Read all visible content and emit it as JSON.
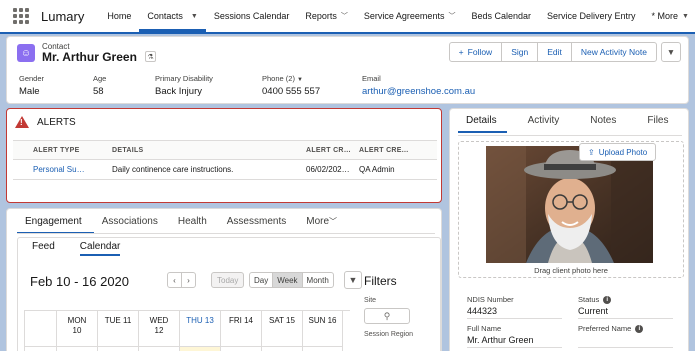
{
  "app": {
    "name": "Lumary"
  },
  "nav": {
    "items": [
      {
        "label": "Home"
      },
      {
        "label": "Contacts"
      },
      {
        "label": "Sessions Calendar"
      },
      {
        "label": "Reports"
      },
      {
        "label": "Service Agreements"
      },
      {
        "label": "Beds Calendar"
      },
      {
        "label": "Service Delivery Entry"
      },
      {
        "label": "* More"
      }
    ]
  },
  "record": {
    "type_label": "Contact",
    "name": "Mr. Arthur Green",
    "actions": {
      "follow": "Follow",
      "sign": "Sign",
      "edit": "Edit",
      "new_activity": "New Activity Note"
    },
    "fields": {
      "gender": {
        "label": "Gender",
        "value": "Male"
      },
      "age": {
        "label": "Age",
        "value": "58"
      },
      "disability": {
        "label": "Primary Disability",
        "value": "Back Injury"
      },
      "phone": {
        "label": "Phone (2)",
        "value": "0400 555 557"
      },
      "email": {
        "label": "Email",
        "value": "arthur@greenshoe.com.au"
      }
    }
  },
  "alerts": {
    "title": "ALERTS",
    "columns": [
      "ALERT TYPE",
      "DETAILS",
      "ALERT CREAT...",
      "ALERT CRE..."
    ],
    "rows": [
      {
        "type": "Personal Supp...",
        "details": "Daily continence care instructions.",
        "created": "06/02/2020 3:...",
        "creator": "QA Admin"
      }
    ]
  },
  "engagement": {
    "tabs": [
      "Engagement",
      "Associations",
      "Health",
      "Assessments",
      "More"
    ],
    "subtabs": [
      "Feed",
      "Calendar"
    ],
    "calendar": {
      "range": "Feb 10 - 16 2020",
      "today_label": "Today",
      "views": [
        "Day",
        "Week",
        "Month"
      ],
      "days": [
        {
          "name": "MON",
          "num": "10"
        },
        {
          "name": "TUE 11",
          "num": ""
        },
        {
          "name": "WED",
          "num": "12"
        },
        {
          "name": "THU 13",
          "num": ""
        },
        {
          "name": "FRI 14",
          "num": ""
        },
        {
          "name": "SAT 15",
          "num": ""
        },
        {
          "name": "SUN 16",
          "num": ""
        }
      ]
    },
    "filters": {
      "title": "Filters",
      "site_label": "Site",
      "region_label": "Session Region"
    }
  },
  "details_panel": {
    "tabs": [
      "Details",
      "Activity",
      "Notes",
      "Files"
    ],
    "upload_label": "Upload Photo",
    "drag_text": "Drag client photo here",
    "fields": {
      "ndis": {
        "label": "NDIS Number",
        "value": "444323"
      },
      "status": {
        "label": "Status",
        "value": "Current"
      },
      "full_name": {
        "label": "Full Name",
        "value": "Mr. Arthur Green"
      },
      "preferred": {
        "label": "Preferred Name",
        "value": ""
      }
    }
  },
  "colors": {
    "brand": "#1b5fb3",
    "alert": "#c23934",
    "contact_icon": "#8b6ff0"
  }
}
